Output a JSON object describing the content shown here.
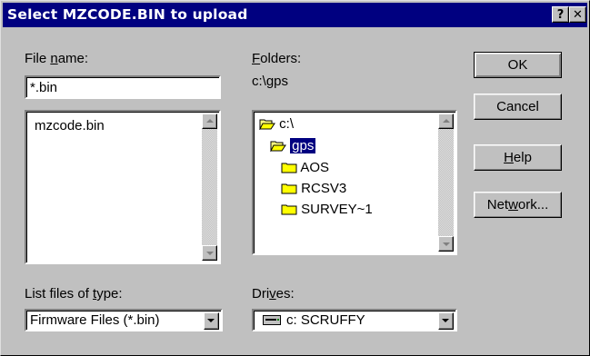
{
  "titlebar": {
    "title": "Select MZCODE.BIN to upload",
    "help_glyph": "?",
    "close_glyph": "✕"
  },
  "file_name": {
    "label_pre": "File ",
    "label_ul": "n",
    "label_post": "ame:",
    "value": "*.bin",
    "files": [
      "mzcode.bin"
    ]
  },
  "folders": {
    "label_ul": "F",
    "label_post": "olders:",
    "current_path": "c:\\gps",
    "tree": [
      {
        "name": "c:\\",
        "icon": "open-folder-icon",
        "selected": false
      },
      {
        "name": "gps",
        "icon": "open-folder-icon",
        "selected": true
      },
      {
        "name": "AOS",
        "icon": "folder-icon",
        "selected": false
      },
      {
        "name": "RCSV3",
        "icon": "folder-icon",
        "selected": false
      },
      {
        "name": "SURVEY~1",
        "icon": "folder-icon",
        "selected": false
      }
    ]
  },
  "buttons": {
    "ok": "OK",
    "cancel": "Cancel",
    "help_ul": "H",
    "help_post": "elp",
    "network_pre": "Net",
    "network_ul": "w",
    "network_post": "ork..."
  },
  "file_type": {
    "label_pre": "List files of ",
    "label_ul": "t",
    "label_post": "ype:",
    "value": "Firmware Files (*.bin)"
  },
  "drives": {
    "label_pre": "Dri",
    "label_ul": "v",
    "label_post": "es:",
    "value": "c: SCRUFFY",
    "icon": "drive-icon"
  },
  "colors": {
    "titlebar": "#000080",
    "face": "#c0c0c0",
    "selection": "#000080"
  }
}
